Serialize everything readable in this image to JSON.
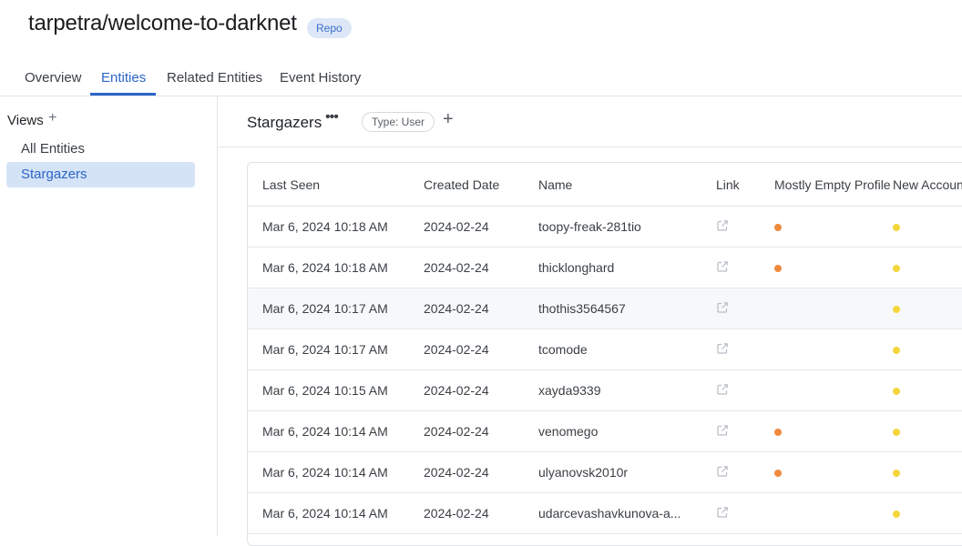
{
  "header": {
    "title": "tarpetra/welcome-to-darknet",
    "badge": "Repo"
  },
  "tabs": [
    {
      "label": "Overview",
      "active": false
    },
    {
      "label": "Entities",
      "active": true
    },
    {
      "label": "Related Entities",
      "active": false
    },
    {
      "label": "Event History",
      "active": false
    }
  ],
  "sidebar": {
    "views_label": "Views",
    "add_icon": "plus-icon",
    "items": [
      {
        "label": "All Entities",
        "active": false
      },
      {
        "label": "Stargazers",
        "active": true
      }
    ]
  },
  "toolbar": {
    "view_title": "Stargazers",
    "more_icon": "ellipsis-icon",
    "filter_chip": "Type: User",
    "add_filter_icon": "plus-icon"
  },
  "table": {
    "columns": [
      "Last Seen",
      "Created Date",
      "Name",
      "Link",
      "Mostly Empty Profile",
      "New Account"
    ],
    "rows": [
      {
        "last_seen": "Mar 6, 2024 10:18 AM",
        "created": "2024-02-24",
        "name": "toopy-freak-281tio",
        "mostly_empty": true,
        "new_account": true
      },
      {
        "last_seen": "Mar 6, 2024 10:18 AM",
        "created": "2024-02-24",
        "name": "thicklonghard",
        "mostly_empty": true,
        "new_account": true
      },
      {
        "last_seen": "Mar 6, 2024 10:17 AM",
        "created": "2024-02-24",
        "name": "thothis3564567",
        "mostly_empty": false,
        "new_account": true
      },
      {
        "last_seen": "Mar 6, 2024 10:17 AM",
        "created": "2024-02-24",
        "name": "tcomode",
        "mostly_empty": false,
        "new_account": true
      },
      {
        "last_seen": "Mar 6, 2024 10:15 AM",
        "created": "2024-02-24",
        "name": "xayda9339",
        "mostly_empty": false,
        "new_account": true
      },
      {
        "last_seen": "Mar 6, 2024 10:14 AM",
        "created": "2024-02-24",
        "name": "venomego",
        "mostly_empty": true,
        "new_account": true
      },
      {
        "last_seen": "Mar 6, 2024 10:14 AM",
        "created": "2024-02-24",
        "name": "ulyanovsk2010r",
        "mostly_empty": true,
        "new_account": true
      },
      {
        "last_seen": "Mar 6, 2024 10:14 AM",
        "created": "2024-02-24",
        "name": "udarcevashavkunova-a...",
        "mostly_empty": false,
        "new_account": true
      }
    ]
  },
  "colors": {
    "accent": "#2b66c9",
    "flag_orange": "#f08a3c",
    "flag_yellow": "#f4d63c"
  }
}
